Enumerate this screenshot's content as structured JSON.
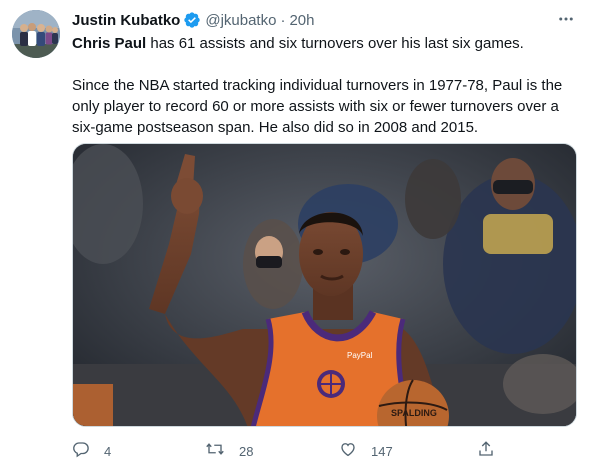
{
  "author": {
    "name": "Justin Kubatko",
    "handle": "@jkubatko",
    "separator": "·",
    "time": "20h",
    "verified": true
  },
  "tweet": {
    "line1_bold": "Chris Paul",
    "line1_rest": " has 61 assists and six turnovers over his last six games.",
    "paragraph2": "Since the NBA started tracking individual turnovers in 1977-78, Paul is the only player to record 60 or more assists with six or fewer turnovers over a six-game postseason span. He also did so in 2008 and 2015."
  },
  "media": {
    "jersey_sponsor": "PayPal",
    "ball_text": "SPALDING"
  },
  "actions": {
    "replies": "4",
    "retweets": "28",
    "likes": "147"
  },
  "colors": {
    "accent": "#1d9bf0",
    "muted": "#536471",
    "jersey": "#e5712c",
    "jersey_trim": "#4b2a7a"
  },
  "icons": [
    "verified-icon",
    "more-icon",
    "reply-icon",
    "retweet-icon",
    "like-icon",
    "share-icon"
  ]
}
